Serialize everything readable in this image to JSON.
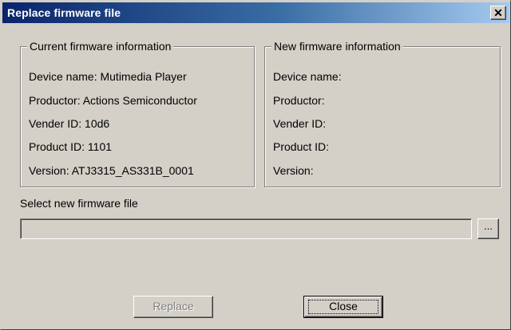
{
  "window": {
    "title": "Replace firmware file",
    "close_glyph": "✕"
  },
  "current_info": {
    "legend": "Current firmware information",
    "device_name": "Device name: Mutimedia Player",
    "productor": "Productor: Actions Semiconductor",
    "vender_id": "Vender ID: 10d6",
    "product_id": "Product ID: 1101",
    "version": "Version:  ATJ3315_AS331B_0001"
  },
  "new_info": {
    "legend": "New firmware information",
    "device_name": "Device name:",
    "productor": "Productor:",
    "vender_id": "Vender ID:",
    "product_id": "Product ID:",
    "version": "Version:"
  },
  "file_select": {
    "label": "Select new firmware file",
    "value": "",
    "browse_label": "..."
  },
  "buttons": {
    "replace_label": "Replace",
    "replace_enabled": false,
    "close_label": "Close"
  },
  "colors": {
    "dialog_face": "#d4d0c8",
    "title_bar_start": "#0a246a",
    "title_bar_end": "#a6caf0",
    "title_text": "#ffffff",
    "disabled_text": "#808080"
  },
  "icons": {
    "close": "close-icon"
  }
}
